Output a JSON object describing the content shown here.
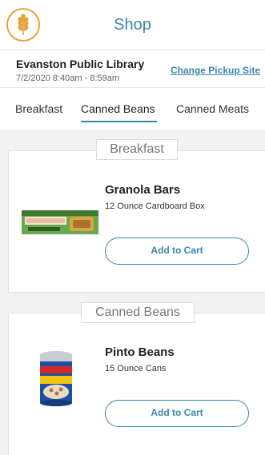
{
  "header": {
    "title": "Shop",
    "logo_icon": "wheat-icon",
    "accent": "#3a86a8",
    "logo_color": "#e8a33d"
  },
  "pickup": {
    "library": "Evanston Public Library",
    "time": "7/2/2020 8:40am - 8:59am",
    "change_label": "Change Pickup Site"
  },
  "tabs": [
    {
      "label": "Breakfast"
    },
    {
      "label": "Canned Beans",
      "active": true
    },
    {
      "label": "Canned Meats"
    }
  ],
  "sections": [
    {
      "label": "Breakfast",
      "product": {
        "name": "Granola Bars",
        "desc": "12 Ounce Cardboard Box",
        "button": "Add to Cart",
        "image_icon": "granola-bar-image"
      }
    },
    {
      "label": "Canned Beans",
      "product": {
        "name": "Pinto Beans",
        "desc": "15 Ounce Cans",
        "button": "Add to Cart",
        "image_icon": "bean-can-image"
      }
    }
  ]
}
